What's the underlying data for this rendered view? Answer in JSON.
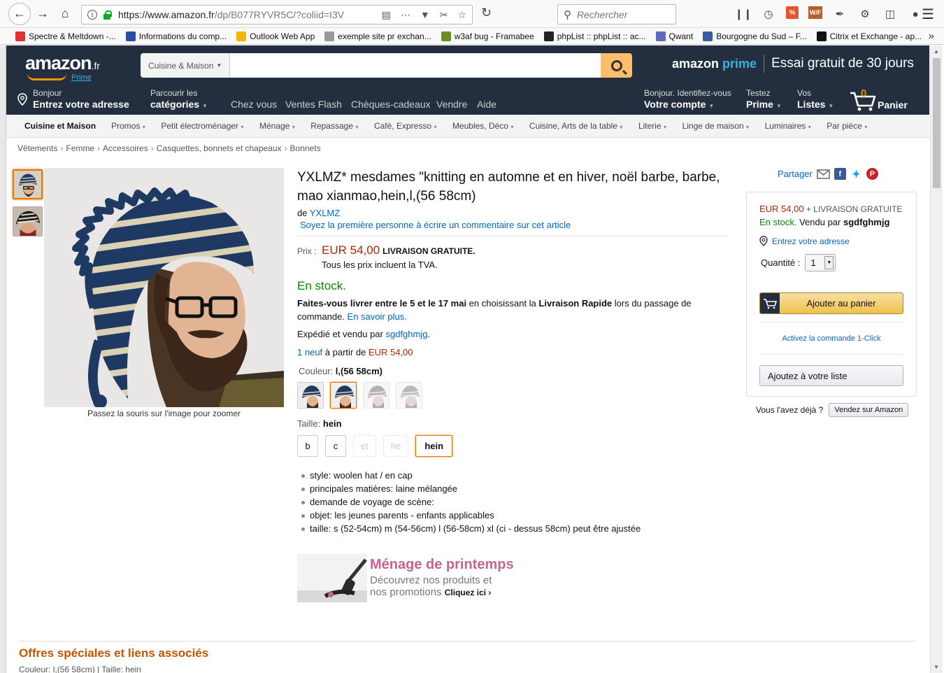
{
  "browser": {
    "url_host": "https://www.amazon.fr",
    "url_path": "/dp/B077RYVR5C/?coliid=I3V",
    "search_placeholder": "Rechercher"
  },
  "bookmarks": [
    {
      "label": "Spectre & Meltdown -...",
      "icon_color": "#d33"
    },
    {
      "label": "Informations du comp...",
      "icon_color": "#2a4da8"
    },
    {
      "label": "Outlook Web App",
      "icon_color": "#f2b705"
    },
    {
      "label": "exemple site pr exchan...",
      "icon_color": "#999"
    },
    {
      "label": "w3af bug - Framabee",
      "icon_color": "#6b8e23"
    },
    {
      "label": "phpList :: phpList :: ac...",
      "icon_color": "#222"
    },
    {
      "label": "Qwant",
      "icon_color": "#5c6bc0"
    },
    {
      "label": "Bourgogne du Sud – F...",
      "icon_color": "#3a5ba0"
    },
    {
      "label": "Citrix et Exchange - ap...",
      "icon_color": "#111"
    }
  ],
  "header": {
    "logo_text": "amazon",
    "logo_suffix": ".fr",
    "logo_prime": "Prime",
    "search_category": "Cuisine & Maison",
    "prime_logo_1": "amazon",
    "prime_logo_2": "prime",
    "prime_trial": "Essai gratuit de 30 jours"
  },
  "nav": {
    "address_small": "Bonjour",
    "address_big": "Entrez votre adresse",
    "browse_small": "Parcourir les",
    "browse_big": "catégories",
    "links": [
      "Chez vous",
      "Ventes Flash",
      "Chèques-cadeaux",
      "Vendre",
      "Aide"
    ],
    "account_small": "Bonjour. Identifiez-vous",
    "account_big": "Votre compte",
    "prime_small": "Testez",
    "prime_big": "Prime",
    "lists_small": "Vos",
    "lists_big": "Listes",
    "cart_count": "0",
    "cart_label": "Panier"
  },
  "subnav": {
    "main": "Cuisine et Maison",
    "items": [
      "Promos",
      "Petit électroménager",
      "Ménage",
      "Repassage",
      "Café, Expresso",
      "Meubles, Déco",
      "Cuisine, Arts de la table",
      "Literie",
      "Linge de maison",
      "Luminaires",
      "Par pièce"
    ]
  },
  "breadcrumb": [
    "Vêtements",
    "Femme",
    "Accessoires",
    "Casquettes, bonnets et chapeaux",
    "Bonnets"
  ],
  "image": {
    "zoom_hint": "Passez la souris sur l'image pour zoomer"
  },
  "product": {
    "title": "YXLMZ* mesdames \"knitting en automne et en hiver, noël barbe, barbe, mao xianmao,hein,l,(56 58cm)",
    "by_prefix": "de",
    "brand": "YXLMZ",
    "review_cta": "Soyez la première personne à écrire un commentaire sur cet article",
    "price_label": "Prix :",
    "price": "EUR 54,00",
    "free_shipping": "LIVRAISON GRATUITE.",
    "vat_note": "Tous les prix incluent la TVA.",
    "stock": "En stock.",
    "delivery_1": "Faites-vous livrer entre le 5 et le 17 mai",
    "delivery_2": " en choisissant la ",
    "delivery_3": "Livraison Rapide",
    "delivery_4": " lors du passage de commande. ",
    "delivery_link": "En savoir plus.",
    "shipped_by_prefix": "Expédié et vendu par ",
    "seller": "sgdfghmjg",
    "shipped_suffix": ".",
    "offers_link": "1 neuf",
    "offers_mid": " à partir de ",
    "offers_price": "EUR 54,00",
    "color_label": "Couleur:",
    "color_value": "l,(56 58cm)",
    "size_label": "Taille:",
    "size_value": "hein",
    "sizes": [
      {
        "label": "b",
        "state": "normal"
      },
      {
        "label": "c",
        "state": "normal"
      },
      {
        "label": "et",
        "state": "disabled"
      },
      {
        "label": "he",
        "state": "disabled"
      },
      {
        "label": "hein",
        "state": "selected"
      }
    ],
    "bullets": [
      "style: woolen hat / en cap",
      "principales matières: laine mélangée",
      "demande de voyage de scène:",
      "objet: les jeunes parents - enfants applicables",
      "taille: s (52-54cm) m (54-56cm) l (56-58cm) xl (ci - dessus 58cm) peut être ajustée"
    ]
  },
  "promo": {
    "title": "Ménage de printemps",
    "line1": "Découvrez nos produits et",
    "line2": "nos promotions",
    "cta": "Cliquez ici ›"
  },
  "buybox": {
    "share": "Partager",
    "price": "EUR 54,00",
    "ship": "+ LIVRAISON GRATUITE",
    "stock": "En stock.",
    "sold_by": " Vendu par ",
    "seller": "sgdfghmjg",
    "address": "Entrez votre adresse",
    "qty_label": "Quantité :",
    "qty_value": "1",
    "add_to_cart": "Ajouter au panier",
    "one_click": "Activez la commande 1-Click",
    "add_list": "Ajoutez à votre liste",
    "sell_question": "Vous l'avez déjà ?",
    "sell_button": "Vendez sur Amazon"
  },
  "footer": {
    "offers_title": "Offres spéciales et liens associés",
    "cut_line": "Couleur: l,(56 58cm) | Taille: hein"
  }
}
